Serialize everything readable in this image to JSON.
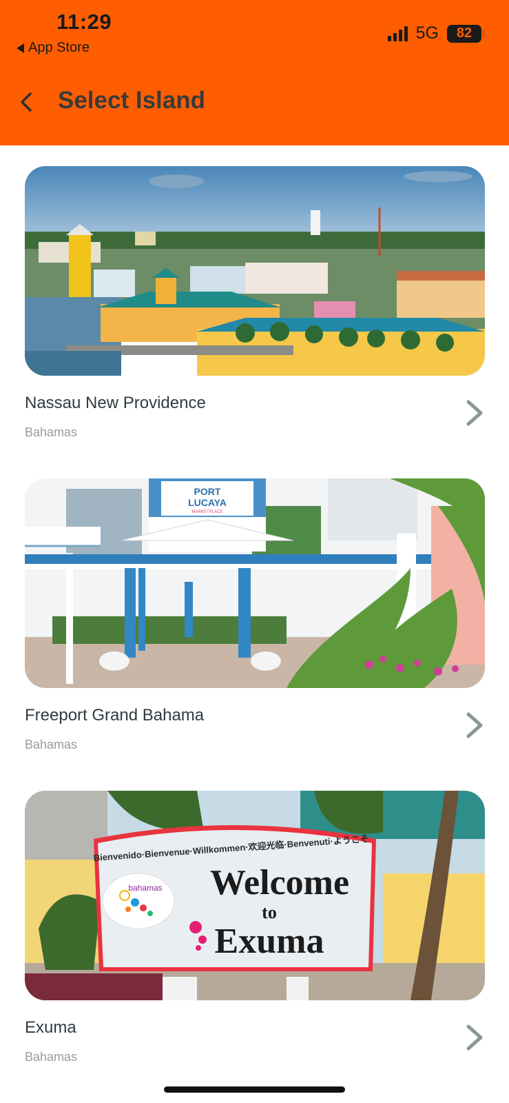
{
  "status_bar": {
    "time": "11:29",
    "back_app": "App Store",
    "network": "5G",
    "battery": "82"
  },
  "header": {
    "title": "Select Island"
  },
  "islands": [
    {
      "name": "Nassau New Providence",
      "country": "Bahamas",
      "image": "nassau-harbor-photo"
    },
    {
      "name": "Freeport Grand Bahama",
      "country": "Bahamas",
      "image": "port-lucaya-marketplace-photo"
    },
    {
      "name": "Exuma",
      "country": "Bahamas",
      "image": "welcome-to-exuma-sign-photo"
    }
  ],
  "photo_text": {
    "port_lucaya_sign_line1": "PORT",
    "port_lucaya_sign_line2": "LUCAYA",
    "port_lucaya_sign_line3": "MARKETPLACE",
    "exuma_greeting": "Bienvenido·Bienvenue·Willkommen·欢迎光临·Benvenuti·ようこそ",
    "exuma_welcome": "Welcome",
    "exuma_to": "to",
    "exuma_place": "Exuma",
    "exuma_logo": "bahamas"
  },
  "colors": {
    "header_bg": "#FF5E00",
    "title_text": "#3a3a3a",
    "chevron": "#8a9598"
  }
}
